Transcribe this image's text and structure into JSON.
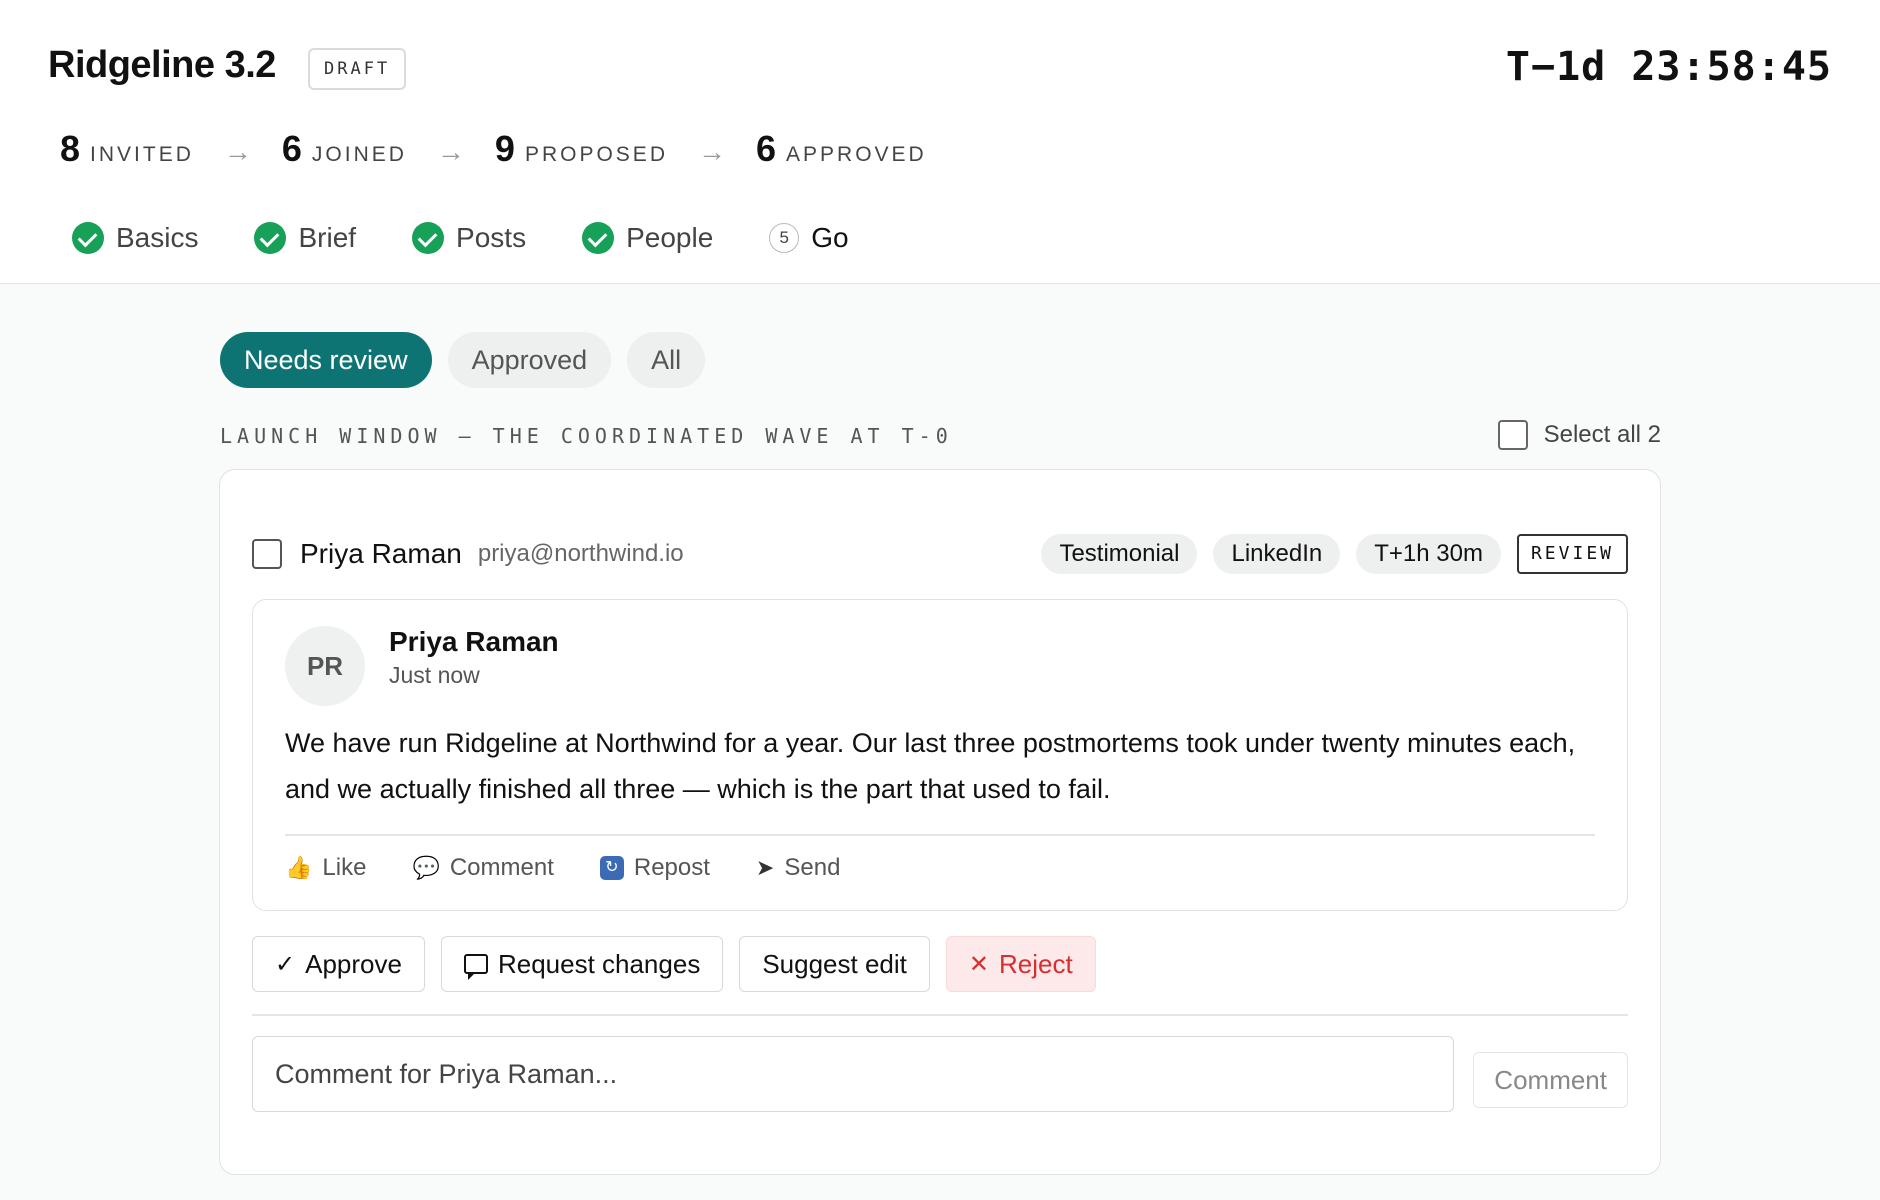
{
  "header": {
    "title": "Ridgeline 3.2",
    "status_badge": "DRAFT",
    "countdown": "T−1d 23:58:45"
  },
  "funnel": [
    {
      "count": "8",
      "label": "INVITED"
    },
    {
      "count": "6",
      "label": "JOINED"
    },
    {
      "count": "9",
      "label": "PROPOSED"
    },
    {
      "count": "6",
      "label": "APPROVED"
    }
  ],
  "funnel_arrow": "→",
  "steps": [
    {
      "label": "Basics",
      "done": true
    },
    {
      "label": "Brief",
      "done": true
    },
    {
      "label": "Posts",
      "done": true
    },
    {
      "label": "People",
      "done": true
    },
    {
      "label": "Go",
      "done": false,
      "number": "5"
    }
  ],
  "filters": [
    {
      "label": "Needs review",
      "active": true
    },
    {
      "label": "Approved",
      "active": false
    },
    {
      "label": "All",
      "active": false
    }
  ],
  "section": {
    "label": "LAUNCH WINDOW — THE COORDINATED WAVE AT T-0",
    "select_all": "Select all 2"
  },
  "item": {
    "author_name": "Priya Raman",
    "author_email": "priya@northwind.io",
    "chips": [
      "Testimonial",
      "LinkedIn",
      "T+1h 30m"
    ],
    "status": "REVIEW",
    "preview": {
      "initials": "PR",
      "name": "Priya Raman",
      "time": "Just now",
      "body": "We have run Ridgeline at Northwind for a year. Our last three postmortems took under twenty minutes each, and we actually finished all three — which is the part that used to fail.",
      "actions": {
        "like": "Like",
        "comment": "Comment",
        "repost": "Repost",
        "send": "Send"
      },
      "icons": {
        "like": "👍",
        "comment": "💬",
        "repost": "↻",
        "send": "➤"
      }
    },
    "buttons": {
      "approve": "Approve",
      "request_changes": "Request changes",
      "suggest_edit": "Suggest edit",
      "reject": "Reject"
    },
    "button_icons": {
      "approve": "✓",
      "reject": "✕"
    },
    "comment_placeholder": "Comment for Priya Raman...",
    "comment_button": "Comment"
  },
  "colors": {
    "accent": "#0e7473",
    "success": "#17a058",
    "danger": "#d62f2f",
    "danger_bg": "#fde9e9"
  }
}
